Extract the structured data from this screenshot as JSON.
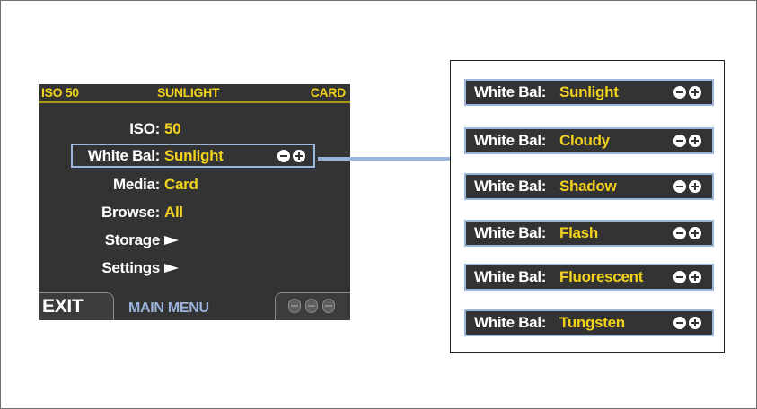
{
  "lcd": {
    "status": {
      "iso": "ISO 50",
      "white_balance": "SUNLIGHT",
      "media": "CARD"
    },
    "menu": [
      {
        "label": "ISO:",
        "value": "50"
      },
      {
        "label": "White Bal:",
        "value": "Sunlight",
        "selected": true
      },
      {
        "label": "Media:",
        "value": "Card"
      },
      {
        "label": "Browse:",
        "value": "All"
      },
      {
        "label": "Storage",
        "value": "arrow-right-icon"
      },
      {
        "label": "Settings",
        "value": "arrow-right-icon"
      }
    ],
    "bottom": {
      "exit": "EXIT",
      "title": "MAIN MENU",
      "dial_icons": [
        "dial-icon",
        "dial-icon",
        "dial-icon"
      ]
    }
  },
  "options": {
    "label": "White Bal:",
    "values": [
      "Sunlight",
      "Cloudy",
      "Shadow",
      "Flash",
      "Fluorescent",
      "Tungsten"
    ]
  },
  "colors": {
    "lcd_bg": "#333333",
    "accent_yellow": "#f2d21c",
    "highlight_blue": "#9ab4dc"
  }
}
